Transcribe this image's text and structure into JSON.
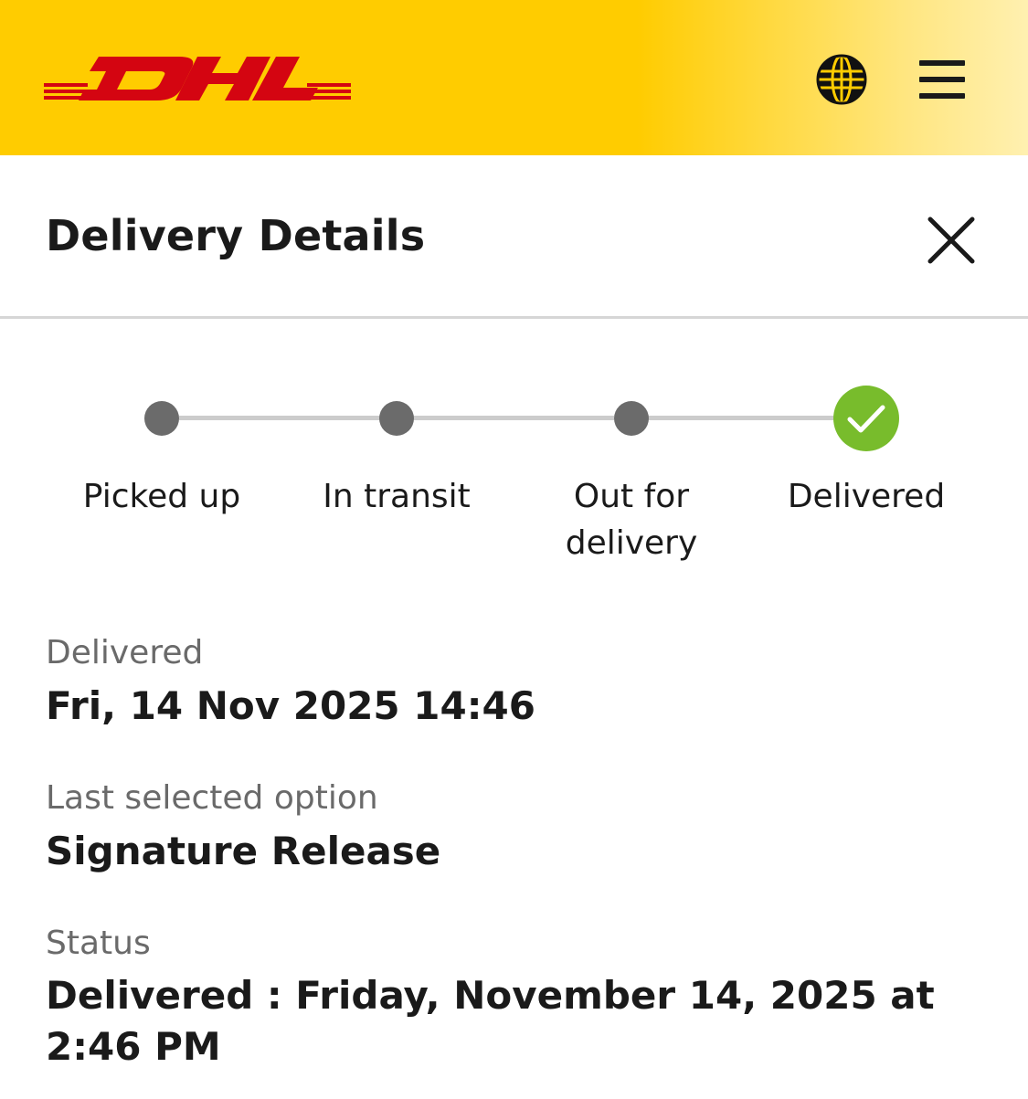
{
  "header": {
    "logo_text": "DHL",
    "globe_icon": "globe-icon",
    "menu_icon": "hamburger-menu-icon",
    "brand_colors": {
      "yellow": "#ffcc00",
      "red": "#d40511"
    }
  },
  "panel": {
    "title": "Delivery Details",
    "close_icon": "close-icon"
  },
  "tracker": {
    "steps": [
      {
        "label": "Picked up",
        "state": "complete"
      },
      {
        "label": "In transit",
        "state": "complete"
      },
      {
        "label": "Out for delivery",
        "state": "complete"
      },
      {
        "label": "Delivered",
        "state": "current",
        "icon": "checkmark-icon"
      }
    ],
    "colors": {
      "dot": "#6b6b6b",
      "line": "#cccccc",
      "done": "#78bc2c"
    }
  },
  "details": {
    "delivered_label": "Delivered",
    "delivered_value": "Fri, 14 Nov 2025 14:46",
    "option_label": "Last selected option",
    "option_value": "Signature Release",
    "status_label": "Status",
    "status_value": "Delivered : Friday, November 14, 2025 at 2:46 PM"
  }
}
